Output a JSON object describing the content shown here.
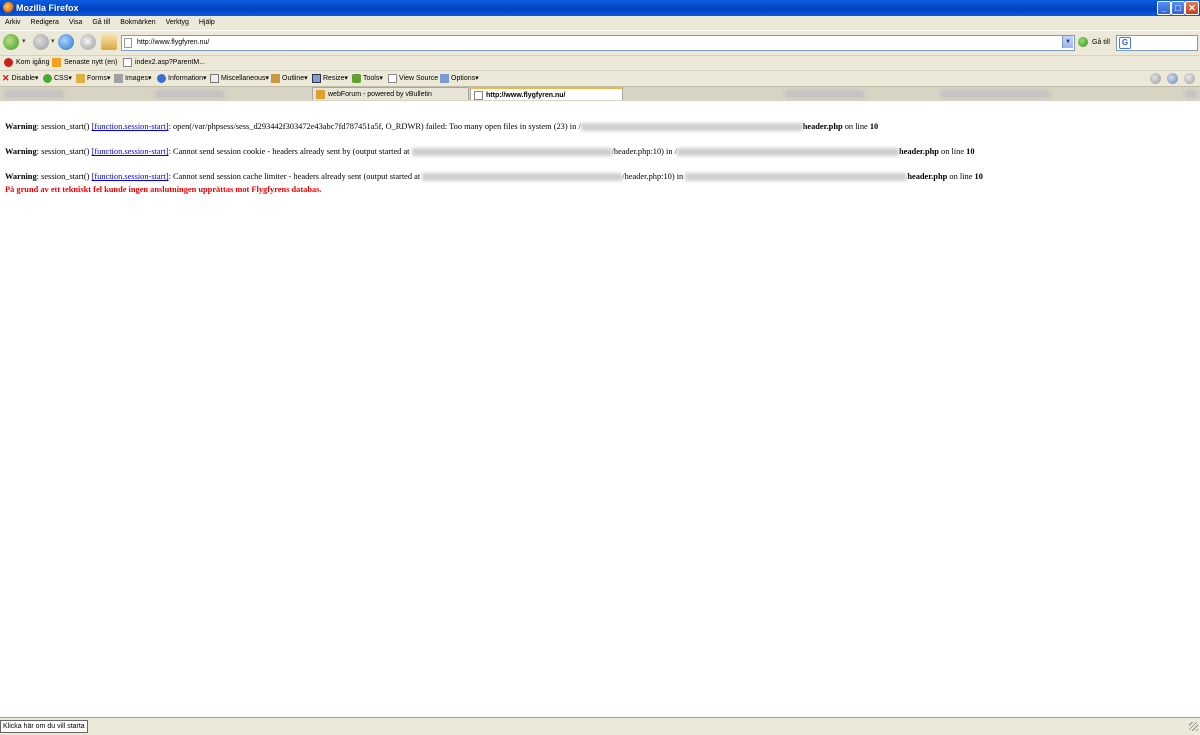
{
  "window": {
    "title": "Mozilla Firefox",
    "minimize": "_",
    "maximize": "□",
    "close": "✕"
  },
  "menu": [
    "Arkiv",
    "Redigera",
    "Visa",
    "Gå till",
    "Bokmärken",
    "Verktyg",
    "Hjälp"
  ],
  "nav": {
    "url": "http://www.flygfyren.nu/",
    "go_label": "Gå till",
    "search_icon": "google-icon",
    "search_glyph": "G"
  },
  "bookmarks": [
    "Kom igång",
    "Senaste nytt (en)",
    "index2.asp?ParentM..."
  ],
  "devtoolbar": [
    "Disable▾",
    "CSS▾",
    "Forms▾",
    "Images▾",
    "Information▾",
    "Miscellaneous▾",
    "Outline▾",
    "Resize▾",
    "Tools▾",
    "View Source",
    "Options▾"
  ],
  "tabs": [
    {
      "label": "webForum - powered by vBulletin",
      "active": false
    },
    {
      "label": "http://www.flygfyren.nu/",
      "active": true
    }
  ],
  "content": {
    "warnings": [
      {
        "label": "Warning",
        "func": "session_start()",
        "link": "[function.session-start]",
        "message": ": open(/var/phpsess/sess_d293442f303472e43abc7fd787451a5f, O_RDWR) failed: Too many open files in system (23) in /",
        "file": "header.php",
        "online": " on line ",
        "line": "10"
      },
      {
        "label": "Warning",
        "func": "session_start()",
        "link": "[function.session-start]",
        "message": ": Cannot send session cookie - headers already sent by (output started at ",
        "mid": "/header.php:10) in /",
        "file": "header.php",
        "online": " on line ",
        "line": "10"
      },
      {
        "label": "Warning",
        "func": "session_start()",
        "link": "[function.session-start]",
        "message": ": Cannot send session cache limiter - headers already sent (output started at ",
        "mid": "/header.php:10) in ",
        "file": "header.php",
        "online": " on line ",
        "line": "10"
      }
    ],
    "db_error": "På grund av ett tekniskt fel kunde ingen anslutningen upprättas mot Flygfyrens databas."
  },
  "status": {
    "text": "Klicka här om du vill starta"
  }
}
